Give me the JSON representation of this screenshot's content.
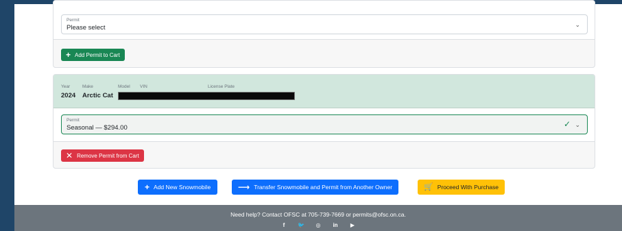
{
  "permit_card_1": {
    "select_label": "Permit",
    "select_value": "Please select",
    "add_button_label": "Add Permit to Cart"
  },
  "vehicle_card": {
    "columns": {
      "year_label": "Year",
      "make_label": "Make",
      "model_label": "Model",
      "vin_label": "VIN",
      "plate_label": "License Plate"
    },
    "year": "2024",
    "make": "Arctic Cat",
    "select_label": "Permit",
    "select_value": "Seasonal — $294.00",
    "remove_button_label": "Remove Permit from Cart"
  },
  "actions": {
    "add_snowmobile_label": "Add New Snowmobile",
    "transfer_label": "Transfer Snowmobile and Permit from Another Owner",
    "proceed_label": "Proceed With Purchase"
  },
  "footer": {
    "help_text": "Need help? Contact OFSC at 705-739-7669 or permits@ofsc.on.ca.",
    "socials": {
      "facebook": "f",
      "twitter": "🐦",
      "instagram": "◎",
      "linkedin": "in",
      "youtube": "▶"
    }
  },
  "colors": {
    "page_background": "#1f4568",
    "vehicle_header": "#d1e7dd",
    "success": "#198754",
    "danger": "#dc3545",
    "primary": "#0d6efd",
    "warning": "#ffc107",
    "footer": "#6c757d"
  }
}
